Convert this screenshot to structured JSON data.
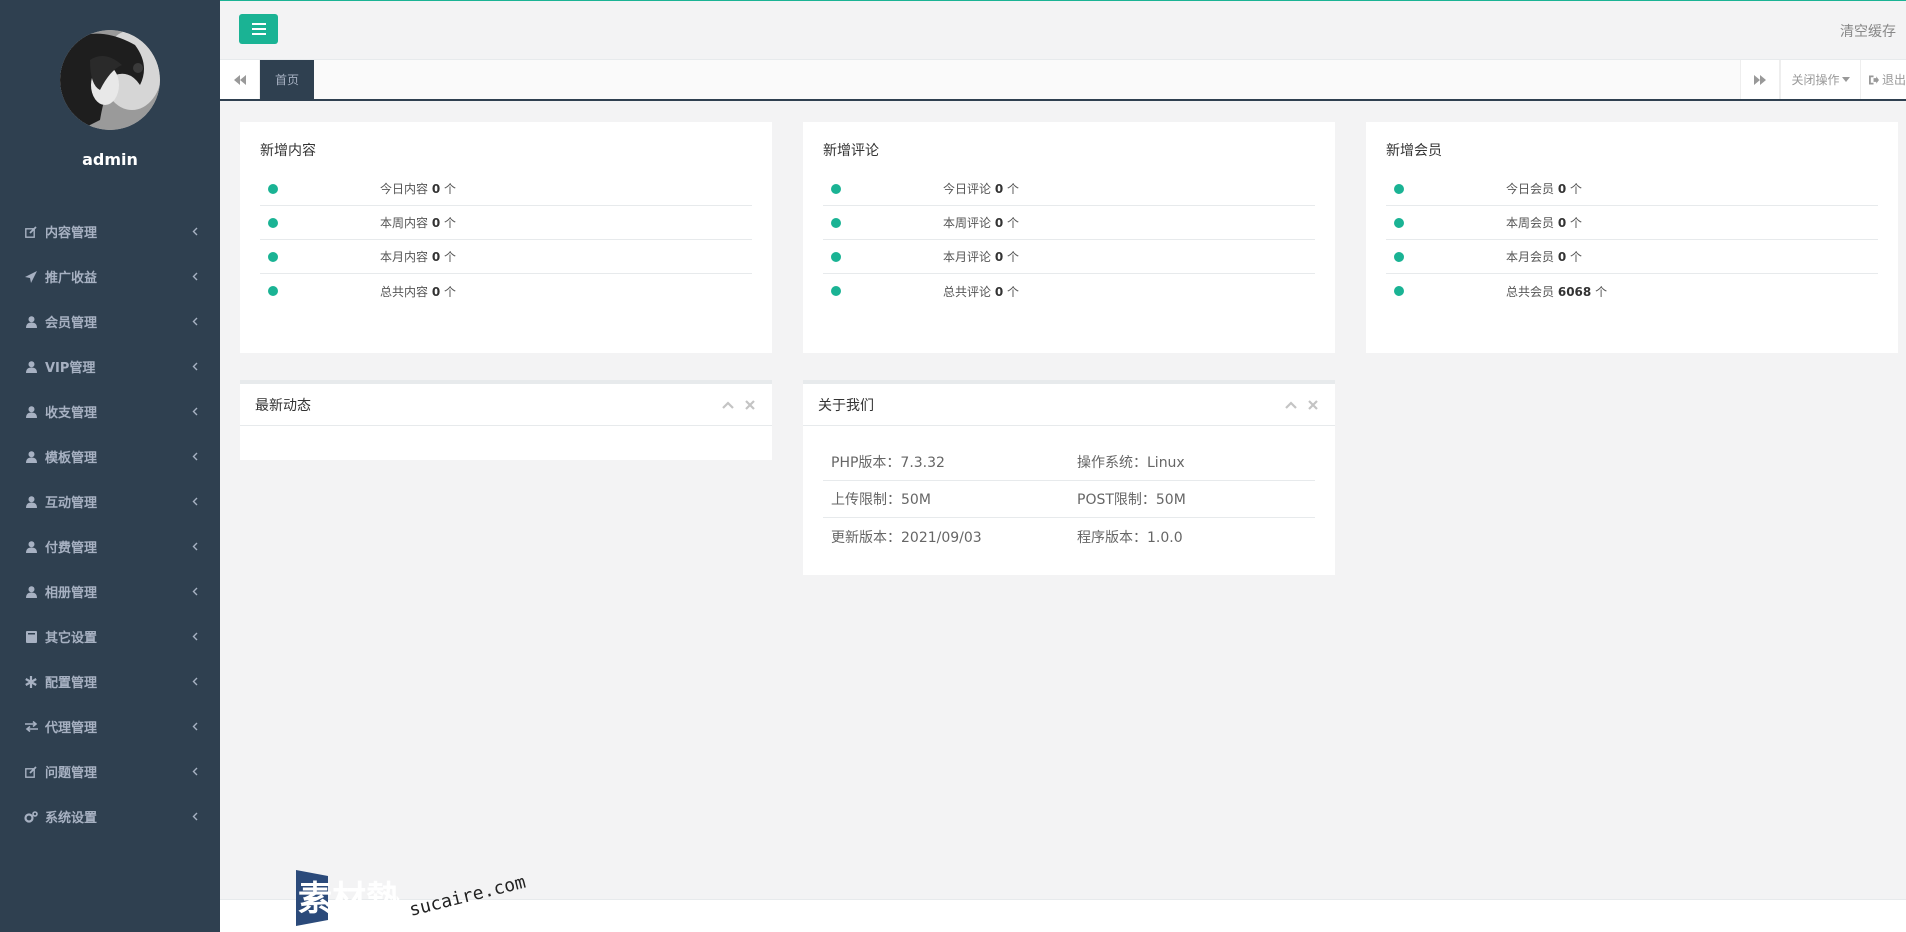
{
  "sidebar": {
    "username": "admin",
    "items": [
      {
        "label": "内容管理",
        "icon": "edit-icon"
      },
      {
        "label": "推广收益",
        "icon": "send-icon"
      },
      {
        "label": "会员管理",
        "icon": "user-icon"
      },
      {
        "label": "VIP管理",
        "icon": "user-icon"
      },
      {
        "label": "收支管理",
        "icon": "user-icon"
      },
      {
        "label": "模板管理",
        "icon": "user-icon"
      },
      {
        "label": "互动管理",
        "icon": "user-icon"
      },
      {
        "label": "付费管理",
        "icon": "user-icon"
      },
      {
        "label": "相册管理",
        "icon": "user-icon"
      },
      {
        "label": "其它设置",
        "icon": "book-icon"
      },
      {
        "label": "配置管理",
        "icon": "asterisk-icon"
      },
      {
        "label": "代理管理",
        "icon": "exchange-icon"
      },
      {
        "label": "问题管理",
        "icon": "edit-icon"
      },
      {
        "label": "系统设置",
        "icon": "gears-icon"
      }
    ]
  },
  "header": {
    "clear_cache": "清空缓存"
  },
  "tabs": {
    "home": "首页",
    "close_ops": "关闭操作",
    "logout": "退出"
  },
  "stats": [
    {
      "title": "新增内容",
      "rows": [
        {
          "label": "今日内容",
          "value": "0",
          "unit": "个"
        },
        {
          "label": "本周内容",
          "value": "0",
          "unit": "个"
        },
        {
          "label": "本月内容",
          "value": "0",
          "unit": "个"
        },
        {
          "label": "总共内容",
          "value": "0",
          "unit": "个"
        }
      ]
    },
    {
      "title": "新增评论",
      "rows": [
        {
          "label": "今日评论",
          "value": "0",
          "unit": "个"
        },
        {
          "label": "本周评论",
          "value": "0",
          "unit": "个"
        },
        {
          "label": "本月评论",
          "value": "0",
          "unit": "个"
        },
        {
          "label": "总共评论",
          "value": "0",
          "unit": "个"
        }
      ]
    },
    {
      "title": "新增会员",
      "rows": [
        {
          "label": "今日会员",
          "value": "0",
          "unit": "个"
        },
        {
          "label": "本周会员",
          "value": "0",
          "unit": "个"
        },
        {
          "label": "本月会员",
          "value": "0",
          "unit": "个"
        },
        {
          "label": "总共会员",
          "value": "6068",
          "unit": "个"
        }
      ]
    }
  ],
  "latest": {
    "title": "最新动态"
  },
  "about": {
    "title": "关于我们",
    "rows": [
      [
        "PHP版本：7.3.32",
        "操作系统：Linux"
      ],
      [
        "上传限制：50M",
        "POST限制：50M"
      ],
      [
        "更新版本：2021/09/03",
        "程序版本：1.0.0"
      ]
    ]
  },
  "watermark": {
    "cn": "素材熱",
    "en": "sucaire.com"
  },
  "colors": {
    "accent": "#1ab394",
    "sidebar": "#2f4050",
    "sidebar_text": "#a7b1c2"
  }
}
